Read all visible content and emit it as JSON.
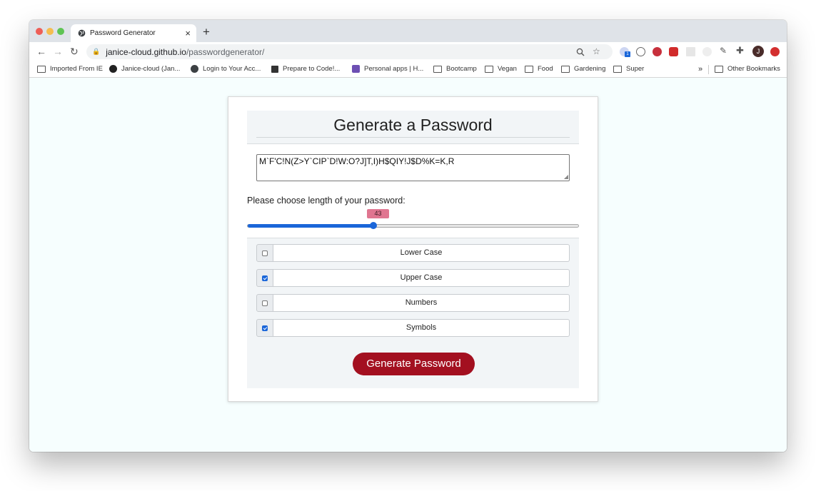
{
  "browser": {
    "tab_title": "Password Generator",
    "url_host": "janice-cloud.github.io",
    "url_path": "/passwordgenerator/",
    "bookmarks": [
      {
        "label": "Imported From IE",
        "icon": "folder-icon"
      },
      {
        "label": "Janice-cloud (Jan...",
        "icon": "github-icon"
      },
      {
        "label": "Login to Your Acc...",
        "icon": "globe-icon"
      },
      {
        "label": "Prepare to Code!...",
        "icon": "book-icon"
      },
      {
        "label": "Personal apps | H...",
        "icon": "heroku-icon"
      },
      {
        "label": "Bootcamp",
        "icon": "folder-icon"
      },
      {
        "label": "Vegan",
        "icon": "folder-icon"
      },
      {
        "label": "Food",
        "icon": "folder-icon"
      },
      {
        "label": "Gardening",
        "icon": "folder-icon"
      },
      {
        "label": "Super",
        "icon": "folder-icon"
      }
    ],
    "overflow_label": "»",
    "other_bookmarks": "Other Bookmarks",
    "profile_initial": "J",
    "extension_badge": "1"
  },
  "app": {
    "title": "Generate a Password",
    "password": "M`F'C!N(Z>Y`CIP`D!W:O?J]T,I)H$QIY!J$D%K=K,R",
    "length_label": "Please choose length of your password:",
    "length_value": "43",
    "length_fraction": 0.38,
    "options": [
      {
        "label": "Lower Case",
        "checked": false
      },
      {
        "label": "Upper Case",
        "checked": true
      },
      {
        "label": "Numbers",
        "checked": false
      },
      {
        "label": "Symbols",
        "checked": true
      }
    ],
    "generate_button": "Generate Password"
  },
  "colors": {
    "accent": "#1a66d9",
    "button": "#a31020",
    "badge": "#e07590"
  }
}
